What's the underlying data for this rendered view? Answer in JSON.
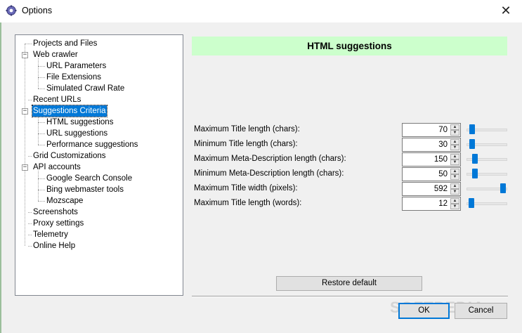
{
  "window": {
    "title": "Options",
    "close_glyph": "✕"
  },
  "tree": {
    "items": [
      {
        "label": "Projects and Files"
      },
      {
        "label": "Web crawler"
      },
      {
        "label": "URL Parameters"
      },
      {
        "label": "File Extensions"
      },
      {
        "label": "Simulated Crawl Rate"
      },
      {
        "label": "Recent URLs"
      },
      {
        "label": "Suggestions Criteria"
      },
      {
        "label": "HTML suggestions"
      },
      {
        "label": "URL suggestions"
      },
      {
        "label": "Performance suggestions"
      },
      {
        "label": "Grid Customizations"
      },
      {
        "label": "API accounts"
      },
      {
        "label": "Google Search Console"
      },
      {
        "label": "Bing webmaster tools"
      },
      {
        "label": "Mozscape"
      },
      {
        "label": "Screenshots"
      },
      {
        "label": "Proxy settings"
      },
      {
        "label": "Telemetry"
      },
      {
        "label": "Online Help"
      }
    ],
    "selected": "Suggestions Criteria"
  },
  "panel": {
    "title": "HTML suggestions",
    "settings": [
      {
        "label": "Maximum Title length (chars):",
        "value": "70",
        "slider_fraction": 0.08
      },
      {
        "label": "Minimum Title length (chars):",
        "value": "30",
        "slider_fraction": 0.08
      },
      {
        "label": "Maximum Meta-Description length (chars):",
        "value": "150",
        "slider_fraction": 0.15
      },
      {
        "label": "Minimum Meta-Description length (chars):",
        "value": "50",
        "slider_fraction": 0.15
      },
      {
        "label": "Maximum Title width (pixels):",
        "value": "592",
        "slider_fraction": 0.95
      },
      {
        "label": "Maximum Title length (words):",
        "value": "12",
        "slider_fraction": 0.05
      }
    ],
    "restore_label": "Restore default"
  },
  "footer": {
    "ok_label": "OK",
    "cancel_label": "Cancel"
  },
  "watermark": "SOFTPEDIA",
  "colors": {
    "selection": "#0078d7",
    "panel_header_bg": "#ccffcc",
    "slider_thumb": "#0078d7"
  },
  "icons": {
    "app": "gear-icon",
    "close": "close-icon",
    "expander": "tree-expander-icon"
  }
}
